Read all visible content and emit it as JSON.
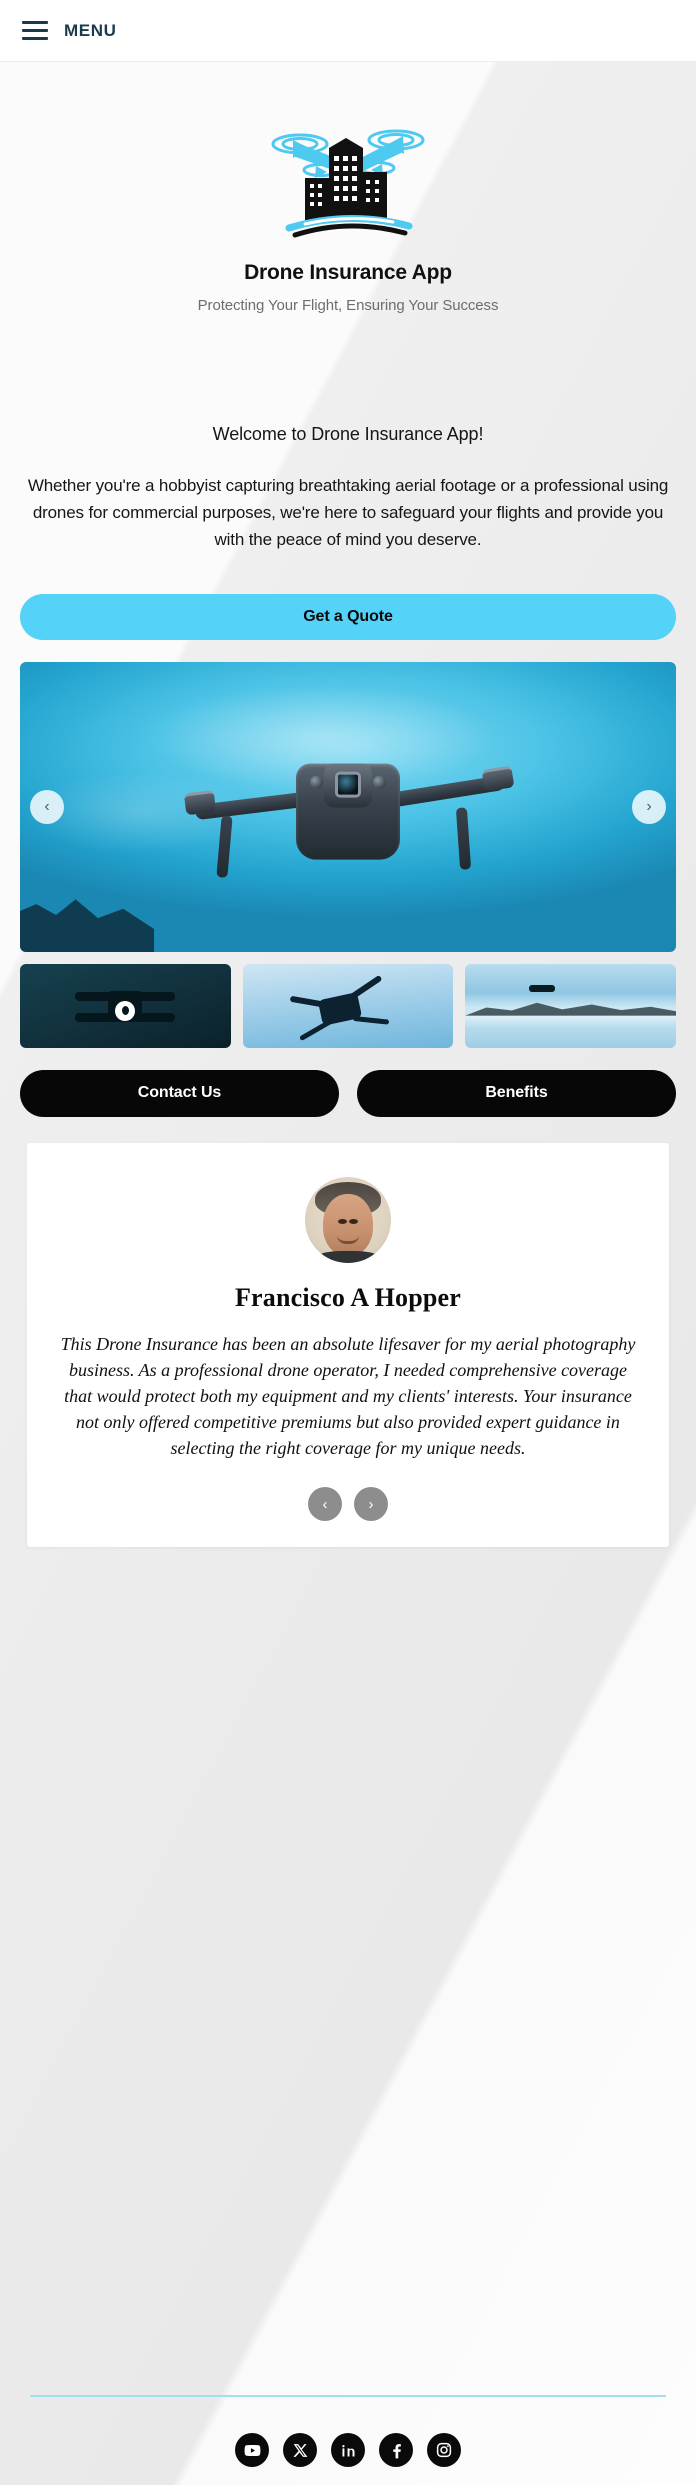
{
  "header": {
    "menu_label": "MENU",
    "menu_icon": "hamburger-icon"
  },
  "brand": {
    "logo_icon": "drone-city-logo",
    "title": "Drone Insurance App",
    "tagline": "Protecting Your Flight, Ensuring Your Success",
    "accent_color": "#54d2f7"
  },
  "intro": {
    "heading": "Welcome to Drone Insurance App!",
    "body": "Whether you're a hobbyist capturing breathtaking aerial footage or a professional using drones for commercial purposes, we're here to safeguard your flights and provide you with the peace of mind you deserve."
  },
  "cta": {
    "quote_label": "Get a Quote"
  },
  "carousel": {
    "prev_label": "‹",
    "next_label": "›",
    "prev_icon": "chevron-left-icon",
    "next_icon": "chevron-right-icon",
    "slides": [
      {
        "alt": "Gray quadcopter drone flying against bright cyan sky"
      },
      {
        "alt": "Dark drone silhouette on deep teal background"
      },
      {
        "alt": "Black drone hovering in pale blue cloudy sky"
      },
      {
        "alt": "Drone flying above mountain range reflected in lake"
      }
    ]
  },
  "buttons": {
    "contact_label": "Contact Us",
    "benefits_label": "Benefits"
  },
  "testimonial": {
    "avatar_icon": "user-avatar-photo",
    "name": "Francisco A Hopper",
    "quote": "This Drone Insurance has been an absolute lifesaver for my aerial photography business. As a professional drone operator, I needed comprehensive coverage that would protect both my equipment and my clients' interests. Your insurance not only offered competitive premiums but also provided expert guidance in selecting the right coverage for my unique needs.",
    "prev_label": "‹",
    "next_label": "›",
    "prev_icon": "chevron-left-icon",
    "next_icon": "chevron-right-icon"
  },
  "footer": {
    "divider_color": "#9fe2ef",
    "socials": [
      {
        "name": "youtube-icon",
        "label": "YouTube"
      },
      {
        "name": "x-icon",
        "label": "X"
      },
      {
        "name": "linkedin-icon",
        "label": "LinkedIn"
      },
      {
        "name": "facebook-icon",
        "label": "Facebook"
      },
      {
        "name": "instagram-icon",
        "label": "Instagram"
      }
    ]
  }
}
